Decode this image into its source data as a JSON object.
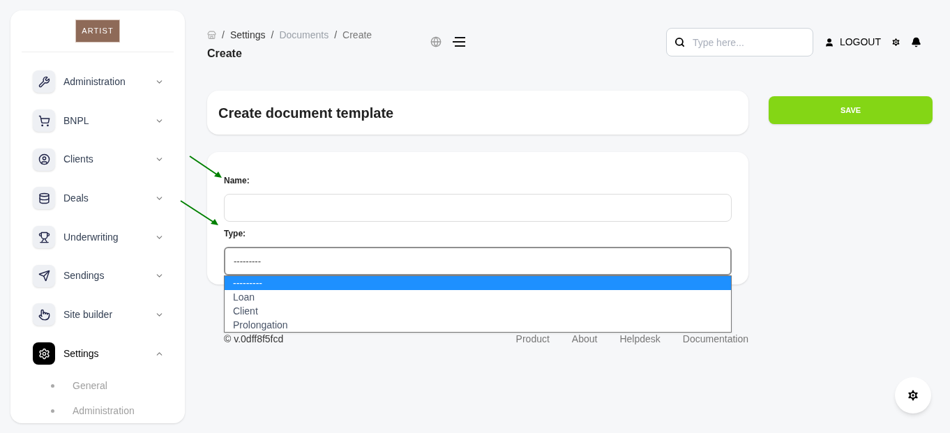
{
  "logo": {
    "text": "ARTIST"
  },
  "sidebar": {
    "items": [
      {
        "label": "Administration",
        "expanded": false
      },
      {
        "label": "BNPL",
        "expanded": false
      },
      {
        "label": "Clients",
        "expanded": false
      },
      {
        "label": "Deals",
        "expanded": false
      },
      {
        "label": "Underwriting",
        "expanded": false
      },
      {
        "label": "Sendings",
        "expanded": false
      },
      {
        "label": "Site builder",
        "expanded": false
      },
      {
        "label": "Settings",
        "expanded": true,
        "children": [
          {
            "label": "General"
          },
          {
            "label": "Administration"
          }
        ]
      }
    ]
  },
  "breadcrumb": [
    {
      "separator": "/",
      "label": "Settings"
    },
    {
      "separator": "/",
      "label": "Documents"
    },
    {
      "separator": "/",
      "label": "Create"
    }
  ],
  "page_title": "Create",
  "search": {
    "placeholder": "Type here..."
  },
  "logout": "LOGOUT",
  "form_title": "Create document template",
  "save_button": "SAVE",
  "fields": [
    {
      "label": "Name:"
    },
    {
      "label": "Type:",
      "value": "---------"
    }
  ],
  "type_options": [
    {
      "label": "---------",
      "selected": true
    },
    {
      "label": "Loan",
      "selected": false
    },
    {
      "label": "Client",
      "selected": false
    },
    {
      "label": "Prolongation",
      "selected": false
    }
  ],
  "footer": {
    "version": "© v.0dff8f5fcd",
    "links": [
      "Product",
      "About",
      "Helpdesk",
      "Documentation"
    ]
  }
}
